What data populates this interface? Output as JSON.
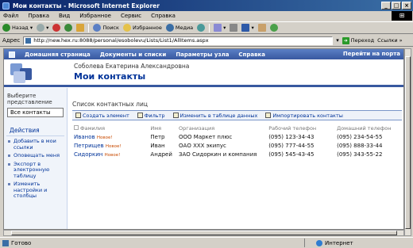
{
  "window": {
    "title": "Мои контакты - Microsoft Internet Explorer"
  },
  "menu": [
    "Файл",
    "Правка",
    "Вид",
    "Избранное",
    "Сервис",
    "Справка"
  ],
  "toolbar": {
    "back": "Назад",
    "search": "Поиск",
    "favorites": "Избранное",
    "media": "Медиа"
  },
  "address": {
    "label": "Адрес",
    "url": "http://new.hex.ru:8088/personal/esobolevu/Lists/List1/AllItems.aspx",
    "go": "Переход",
    "links": "Ссылки"
  },
  "site_nav": {
    "items": [
      "Домашняя страница",
      "Документы и списки",
      "Параметры узла",
      "Справка"
    ],
    "right": "Перейти на порта"
  },
  "header": {
    "user_name": "Соболева Екатерина Александровна",
    "page_title": "Мои контакты"
  },
  "sidebar": {
    "view_label": "Выберите представление",
    "current_view": "Все контакты",
    "actions_title": "Действия",
    "actions": [
      "Добавить в мои ссылки",
      "Оповещать меня",
      "Экспорт в электронную таблицу",
      "Изменить настройки и столбцы"
    ]
  },
  "list": {
    "title": "Список контактных лиц",
    "toolbar": [
      "Создать элемент",
      "Фильтр",
      "Изменить в таблице данных",
      "Импортировать контакты"
    ],
    "columns": [
      "Фамилия",
      "Имя",
      "Организация",
      "Рабочий телефон",
      "Домашний телефон"
    ],
    "new_badge": "Новое!",
    "rows": [
      [
        "Иванов",
        "Петр",
        "ООО Маркет плюс",
        "(095) 123-34-43",
        "(095) 234-54-55"
      ],
      [
        "Петрищев",
        "Иван",
        "ОАО XXX экипус",
        "(095) 777-44-55",
        "(095) 888-33-44"
      ],
      [
        "Сидоркин",
        "Андрей",
        "ЗАО Сидоркин и компания",
        "(095) 545-43-45",
        "(095) 343-55-22"
      ]
    ]
  },
  "status": {
    "left": "Готово",
    "right": "Интернет"
  },
  "colors": {
    "title_bar": "#0a246a",
    "nav_bar": "#3858a0",
    "link": "#003399"
  }
}
